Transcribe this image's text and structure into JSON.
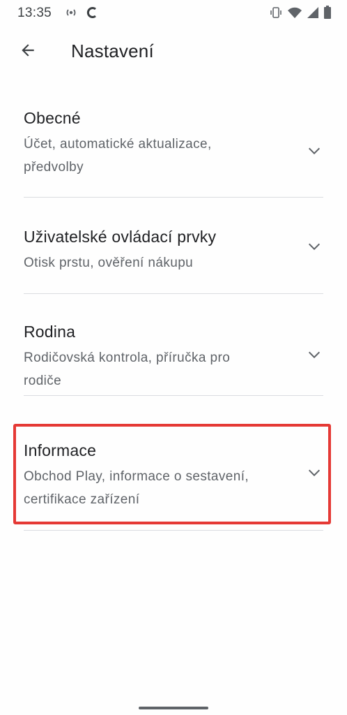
{
  "status_bar": {
    "time": "13:35",
    "icons_left": [
      "radio-icon",
      "c-app-icon"
    ],
    "icons_right": [
      "vibrate-icon",
      "wifi-icon",
      "signal-icon",
      "battery-icon"
    ]
  },
  "app_bar": {
    "title": "Nastavení",
    "back_icon": "arrow-back-icon"
  },
  "sections": [
    {
      "title": "Obecné",
      "subtitle_line1": "Účet, automatické aktualizace,",
      "subtitle_line2": "předvolby"
    },
    {
      "title": "Uživatelské ovládací prvky",
      "subtitle_line1": "Otisk prstu, ověření nákupu",
      "subtitle_line2": ""
    },
    {
      "title": "Rodina",
      "subtitle_line1": "Rodičovská kontrola, příručka pro",
      "subtitle_line2": "rodiče"
    },
    {
      "title": "Informace",
      "subtitle_line1": "Obchod Play, informace o sestavení,",
      "subtitle_line2": "certifikace zařízení"
    }
  ],
  "highlight_color": "#e53935",
  "accent_text_color": "#202124",
  "secondary_text_color": "#5f6368"
}
